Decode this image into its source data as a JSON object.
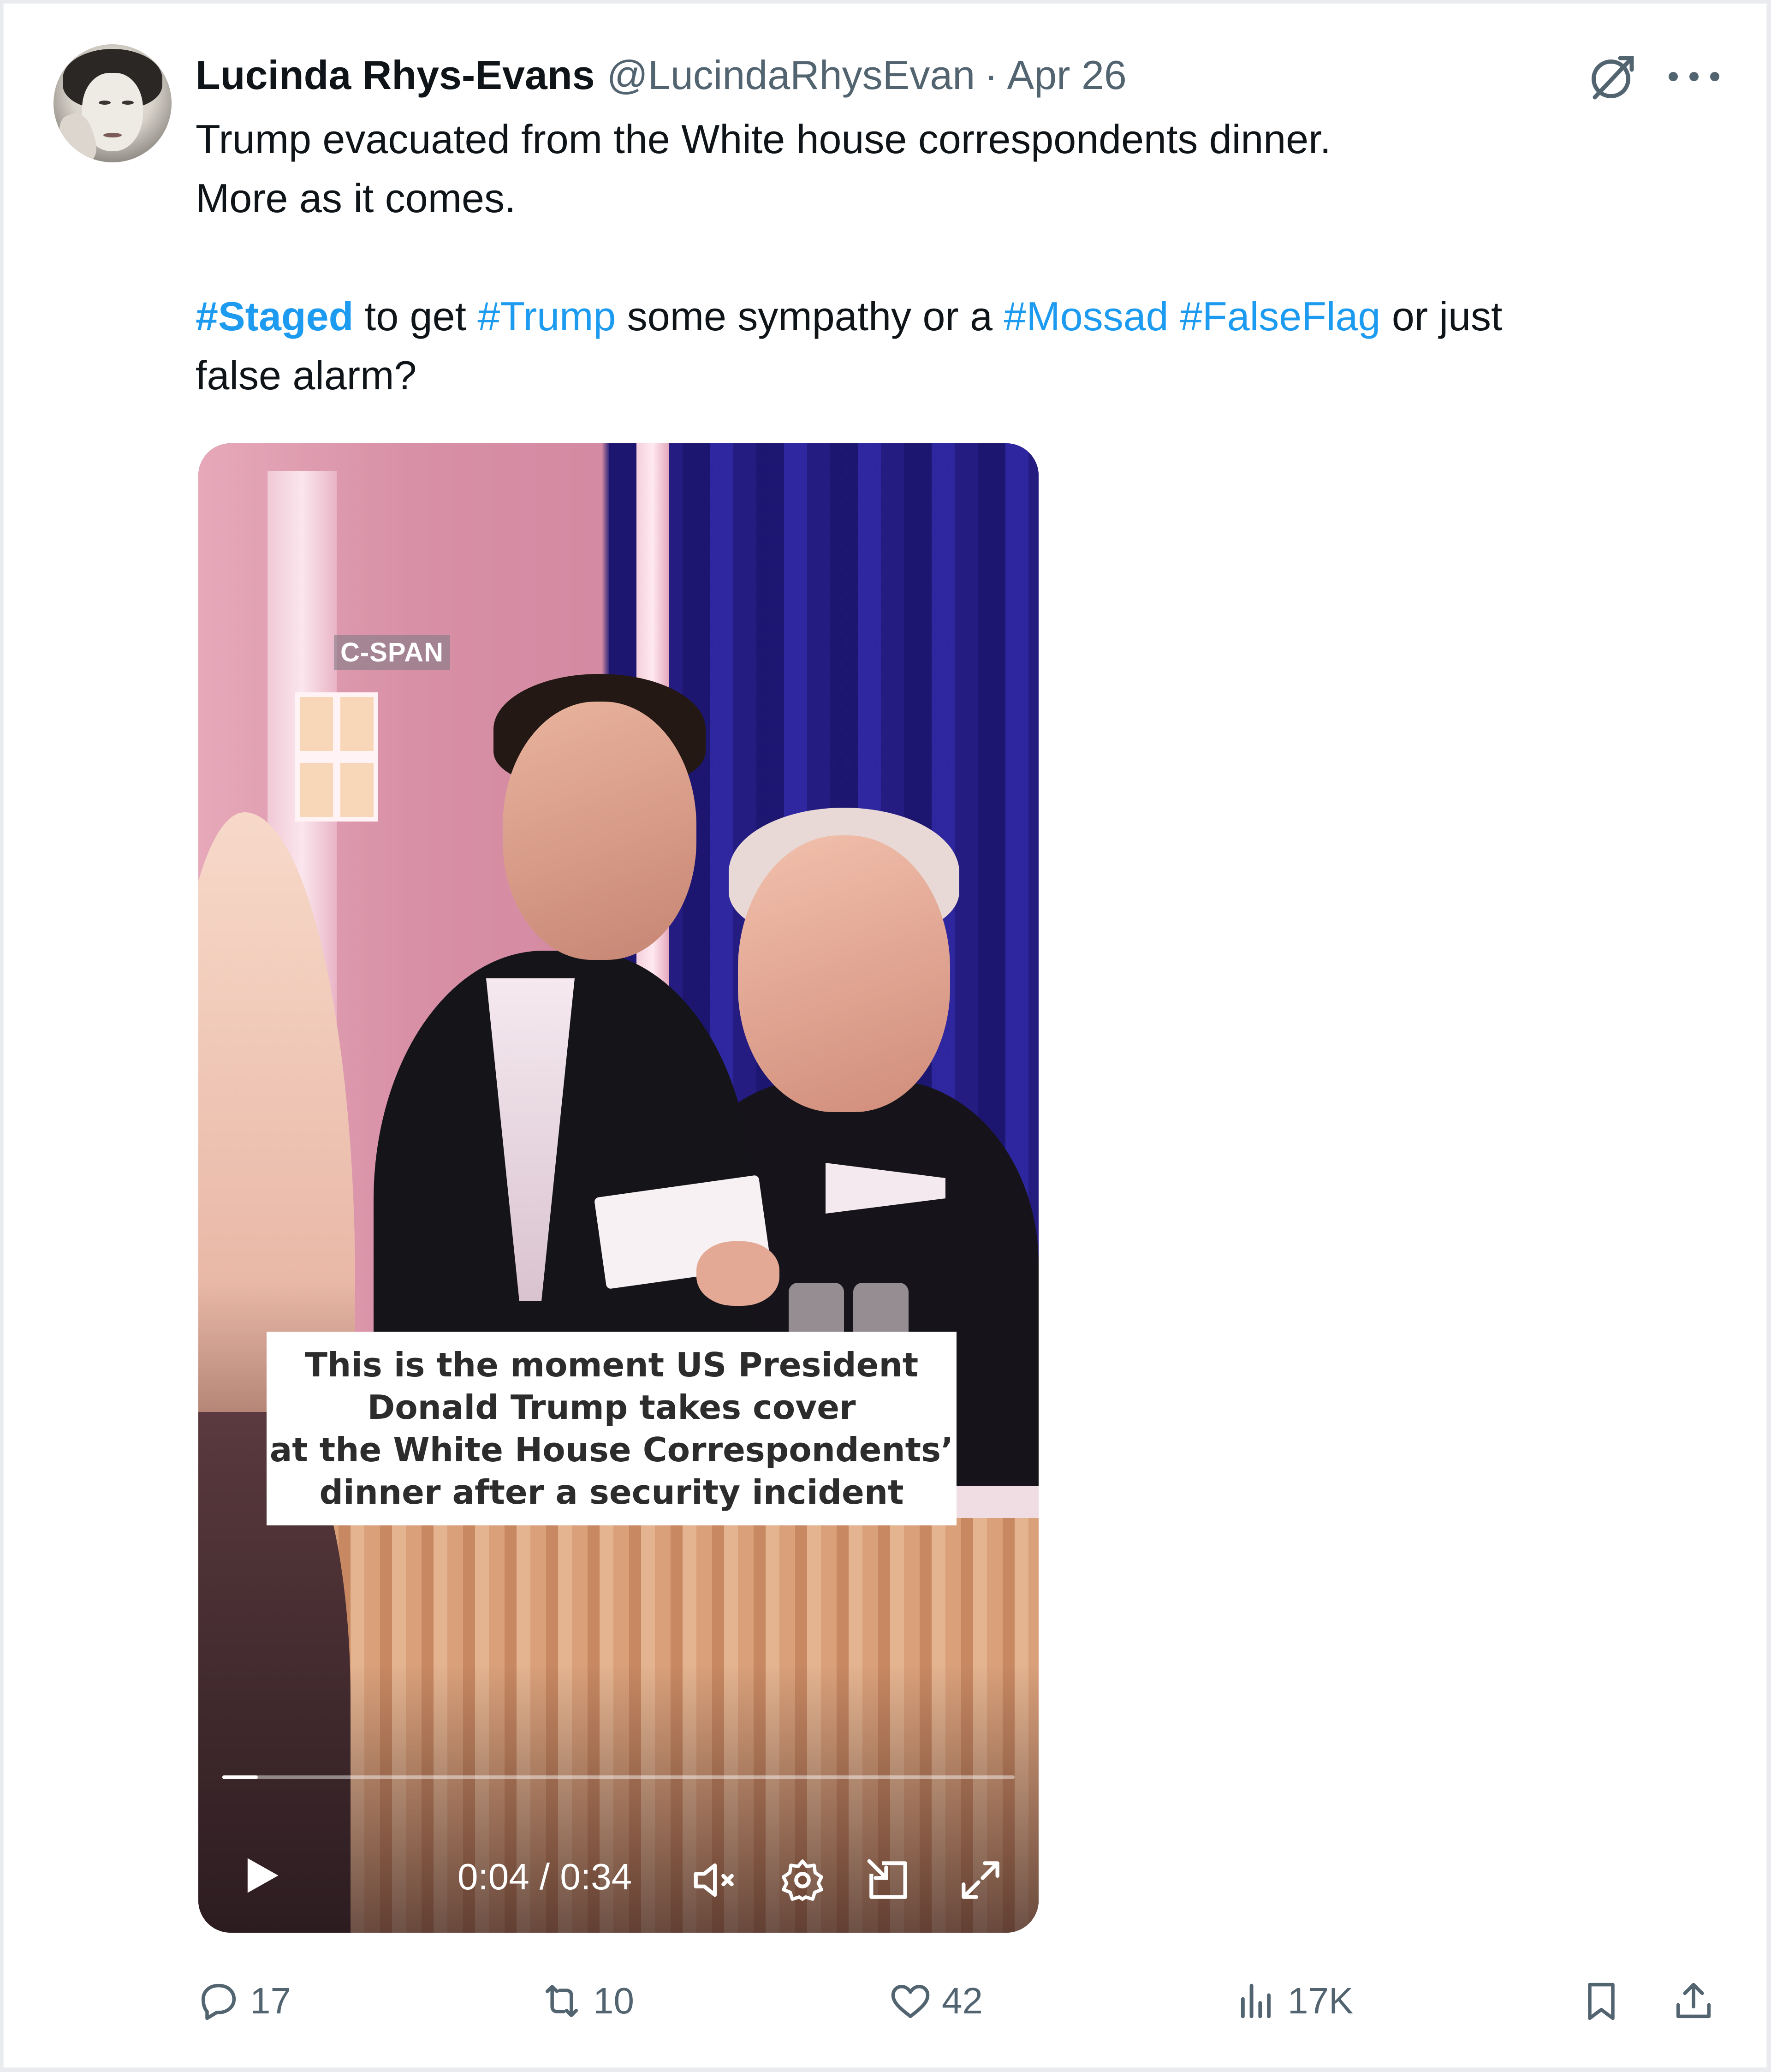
{
  "post": {
    "author_name": "Lucinda Rhys-Evans",
    "handle": "@LucindaRhysEvan",
    "separator": "·",
    "date": "Apr 26",
    "line1": "Trump evacuated from the White house correspondents dinner.",
    "line2": "More as it comes.",
    "line3_parts": {
      "tag1": "#Staged",
      "t1": " to get ",
      "tag2": "#Trump",
      "t2": " some sympathy or a  ",
      "tag3": "#Mossad",
      "t3": " ",
      "tag4": "#FalseFlag",
      "t4": " or just"
    },
    "line4": "false alarm?"
  },
  "video": {
    "watermark": "C-SPAN",
    "caption_lines": [
      "This is the moment US President",
      "Donald Trump takes cover",
      "at the White House Correspondents’",
      "dinner after a security incident"
    ],
    "time": "0:04 / 0:34",
    "progress_fraction": 0.045
  },
  "actions": {
    "replies": "17",
    "reposts": "10",
    "likes": "42",
    "views": "17K"
  },
  "icons": [
    "grok-icon",
    "more-icon",
    "play-icon",
    "mute-icon",
    "settings-icon",
    "pip-icon",
    "fullscreen-icon",
    "reply-icon",
    "repost-icon",
    "like-icon",
    "views-icon",
    "bookmark-icon",
    "share-icon"
  ],
  "colors": {
    "link": "#1d9bf0",
    "muted": "#536471",
    "text": "#0f1419"
  }
}
